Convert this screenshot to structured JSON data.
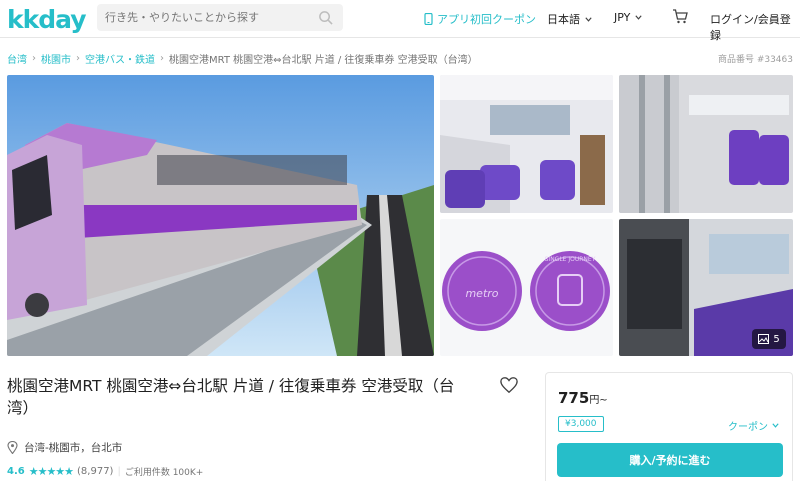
{
  "header": {
    "logo": "kkday",
    "search_placeholder": "行き先・やりたいことから探す",
    "app_coupon": "アプリ初回クーポン",
    "language": "日本語",
    "currency": "JPY",
    "login": "ログイン/会員登録"
  },
  "breadcrumb": {
    "items": [
      "台湾",
      "桃園市",
      "空港バス・鉄道"
    ],
    "current": "桃園空港MRT 桃園空港⇔台北駅 片道 / 往復乗車券 空港受取（台湾）",
    "separator": "›"
  },
  "product_number": "商品番号 #33463",
  "gallery": {
    "photo_count": "5",
    "coin1_text": "metro",
    "coin2_text": "SINGLE JOURNEY"
  },
  "product": {
    "title": "桃園空港MRT 桃園空港⇔台北駅 片道 / 往復乗車券 空港受取（台湾）",
    "location": "台湾-桃園市，台北市",
    "rating": "4.6",
    "stars": "★★★★★",
    "review_count": "(8,977)",
    "used_count": "ご利用件数 100K+"
  },
  "booking": {
    "price": "775",
    "price_unit": "円~",
    "coupon_tag": "¥3,000",
    "coupon_link": "クーポン",
    "buy_button": "購入/予約に進む"
  },
  "colors": {
    "brand": "#26bec9",
    "train_purple": "#9b4fc9"
  }
}
